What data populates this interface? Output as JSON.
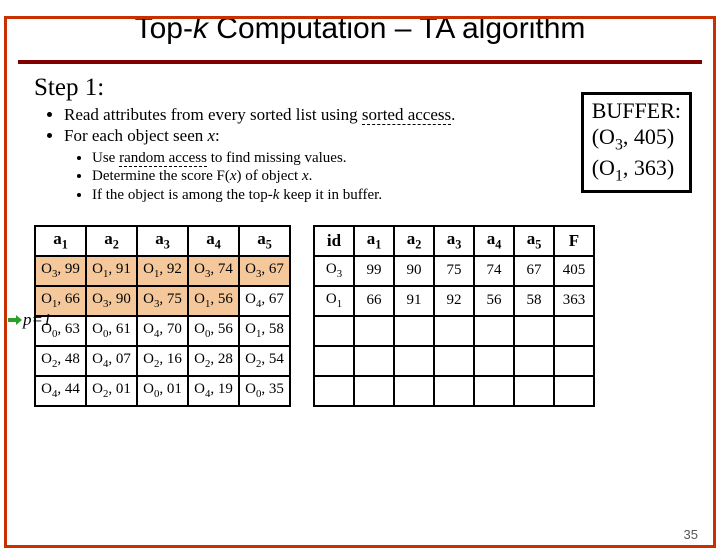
{
  "title_a": "Top-",
  "title_k": "k",
  "title_b": " Computation – TA algorithm",
  "step": "Step 1:",
  "b1a": "Read attributes from every sorted list using ",
  "b1u": "sorted access",
  "b1b": ".",
  "b2a": "For each object seen ",
  "b2x": "x",
  "b2b": ":",
  "s1a": "Use ",
  "s1u": "random access",
  "s1b": " to find missing values.",
  "s2a": "Determine the score F(",
  "s2x": "x",
  "s2b": ") of object ",
  "s2x2": "x",
  "s2c": ".",
  "s3a": "If the object is among the top-",
  "s3k": "k",
  "s3b": " keep it in buffer.",
  "buf_title": "BUFFER:",
  "buf_l1a": "(O",
  "buf_l1s": "3",
  "buf_l1b": ", 405)",
  "buf_l2a": "(O",
  "buf_l2s": "1",
  "buf_l2b": ", 363)",
  "pm_a": "p",
  "pm_b": "=1",
  "hL": {
    "a1": "a",
    "n1": "1",
    "a2": "a",
    "n2": "2",
    "a3": "a",
    "n3": "3",
    "a4": "a",
    "n4": "4",
    "a5": "a",
    "n5": "5"
  },
  "L": [
    [
      {
        "o": "O",
        "s": "3",
        "v": ", 99"
      },
      {
        "o": "O",
        "s": "1",
        "v": ", 91"
      },
      {
        "o": "O",
        "s": "1",
        "v": ", 92"
      },
      {
        "o": "O",
        "s": "3",
        "v": ", 74"
      },
      {
        "o": "O",
        "s": "3",
        "v": ", 67"
      }
    ],
    [
      {
        "o": "O",
        "s": "1",
        "v": ", 66"
      },
      {
        "o": "O",
        "s": "3",
        "v": ", 90"
      },
      {
        "o": "O",
        "s": "3",
        "v": ", 75"
      },
      {
        "o": "O",
        "s": "1",
        "v": ", 56"
      },
      {
        "o": "O",
        "s": "4",
        "v": ", 67"
      }
    ],
    [
      {
        "o": "O",
        "s": "0",
        "v": ", 63"
      },
      {
        "o": "O",
        "s": "0",
        "v": ", 61"
      },
      {
        "o": "O",
        "s": "4",
        "v": ", 70"
      },
      {
        "o": "O",
        "s": "0",
        "v": ", 56"
      },
      {
        "o": "O",
        "s": "1",
        "v": ", 58"
      }
    ],
    [
      {
        "o": "O",
        "s": "2",
        "v": ", 48"
      },
      {
        "o": "O",
        "s": "4",
        "v": ", 07"
      },
      {
        "o": "O",
        "s": "2",
        "v": ", 16"
      },
      {
        "o": "O",
        "s": "2",
        "v": ", 28"
      },
      {
        "o": "O",
        "s": "2",
        "v": ", 54"
      }
    ],
    [
      {
        "o": "O",
        "s": "4",
        "v": ", 44"
      },
      {
        "o": "O",
        "s": "2",
        "v": ", 01"
      },
      {
        "o": "O",
        "s": "0",
        "v": ", 01"
      },
      {
        "o": "O",
        "s": "4",
        "v": ", 19"
      },
      {
        "o": "O",
        "s": "0",
        "v": ", 35"
      }
    ]
  ],
  "hR": {
    "id": "id",
    "a1": "a",
    "n1": "1",
    "a2": "a",
    "n2": "2",
    "a3": "a",
    "n3": "3",
    "a4": "a",
    "n4": "4",
    "a5": "a",
    "n5": "5",
    "F": "F"
  },
  "R": [
    {
      "ido": "O",
      "ids": "3",
      "a1": "99",
      "a2": "90",
      "a3": "75",
      "a4": "74",
      "a5": "67",
      "F": "405"
    },
    {
      "ido": "O",
      "ids": "1",
      "a1": "66",
      "a2": "91",
      "a3": "92",
      "a4": "56",
      "a5": "58",
      "F": "363"
    }
  ],
  "page": "35"
}
